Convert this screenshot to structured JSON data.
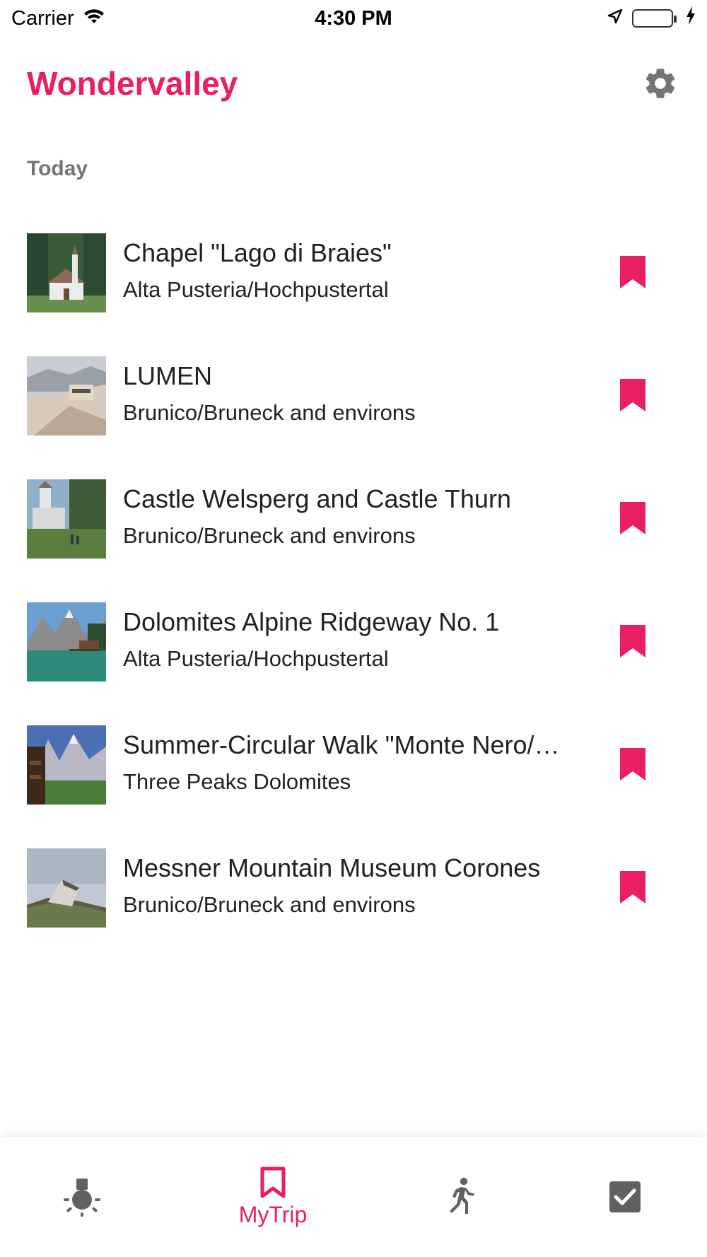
{
  "status": {
    "carrier": "Carrier",
    "time": "4:30 PM"
  },
  "header": {
    "title": "Wondervalley"
  },
  "section": {
    "label": "Today"
  },
  "items": [
    {
      "title": "Chapel \"Lago di Braies\"",
      "subtitle": "Alta Pusteria/Hochpustertal",
      "image": "chapel-photo"
    },
    {
      "title": "LUMEN",
      "subtitle": "Brunico/Bruneck and environs",
      "image": "lumen-museum-photo"
    },
    {
      "title": "Castle Welsperg and Castle Thurn",
      "subtitle": "Brunico/Bruneck and environs",
      "image": "castle-photo"
    },
    {
      "title": "Dolomites Alpine Ridgeway No. 1",
      "subtitle": "Alta Pusteria/Hochpustertal",
      "image": "lake-mountain-photo"
    },
    {
      "title": "Summer-Circular Walk \"Monte Nero/…",
      "subtitle": "Three Peaks Dolomites",
      "image": "peaks-hut-photo"
    },
    {
      "title": "Messner Mountain Museum Corones",
      "subtitle": "Brunico/Bruneck and environs",
      "image": "museum-photo"
    }
  ],
  "tabbar": {
    "tabs": [
      {
        "icon": "lightbulb-icon",
        "label": ""
      },
      {
        "icon": "bookmark-icon",
        "label": "MyTrip",
        "active": true
      },
      {
        "icon": "running-person-icon",
        "label": ""
      },
      {
        "icon": "checkbox-icon",
        "label": ""
      }
    ]
  },
  "colors": {
    "accent": "#e91e63",
    "inactive_icon": "#616161"
  }
}
